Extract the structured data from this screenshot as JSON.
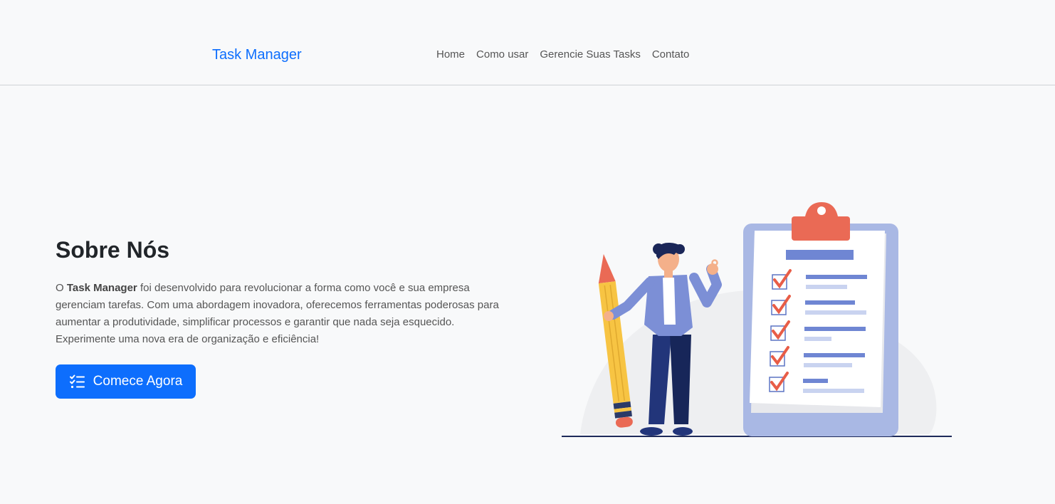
{
  "navbar": {
    "brand": "Task Manager",
    "links": [
      "Home",
      "Como usar",
      "Gerencie Suas Tasks",
      "Contato"
    ]
  },
  "hero": {
    "title": "Sobre Nós",
    "text_before": "O ",
    "text_bold": "Task Manager",
    "text_after": " foi desenvolvido para revolucionar a forma como você e sua empresa gerenciam tarefas. Com uma abordagem inovadora, oferecemos ferramentas poderosas para aumentar a produtividade, simplificar processos e garantir que nada seja esquecido. Experimente uma nova era de organização e eficiência!",
    "cta_label": "Comece Agora",
    "cta_icon": "checklist-icon"
  },
  "illustration": {
    "icon": "person-with-pencil-and-checklist-clipboard-illustration"
  },
  "colors": {
    "primary": "#0d6efd",
    "background": "#f8f9fa",
    "clipboard": "#a9b8e4",
    "accent": "#ea6a55",
    "pencil": "#f7c443"
  }
}
